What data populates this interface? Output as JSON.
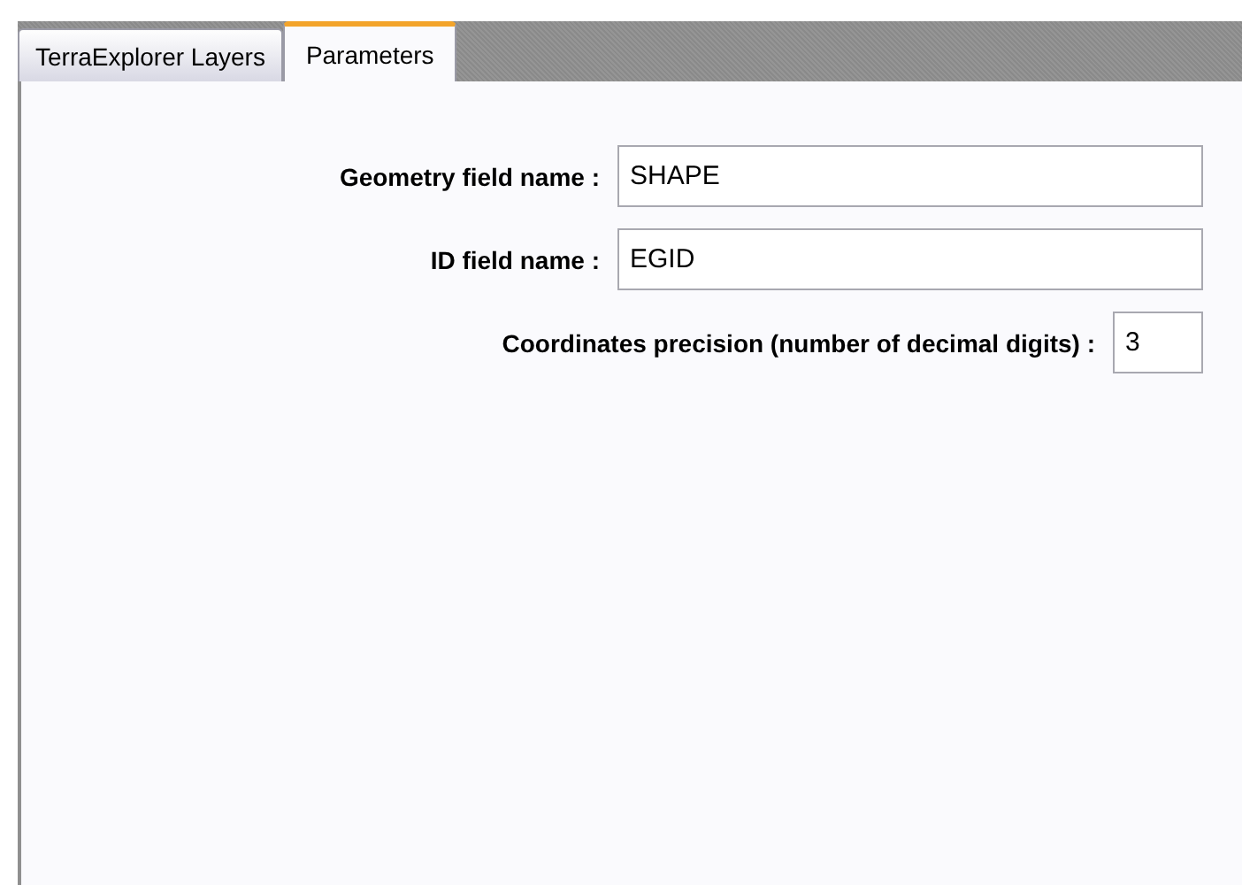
{
  "tabs": [
    {
      "label": "TerraExplorer Layers",
      "selected": false
    },
    {
      "label": "Parameters",
      "selected": true
    }
  ],
  "fields": [
    {
      "label": "Geometry field name :",
      "value": "SHAPE",
      "kind": "wide"
    },
    {
      "label": "ID field name :",
      "value": "EGID",
      "kind": "wide"
    },
    {
      "label": "Coordinates precision (number of decimal digits) :",
      "value": "3",
      "kind": "narrow"
    }
  ]
}
